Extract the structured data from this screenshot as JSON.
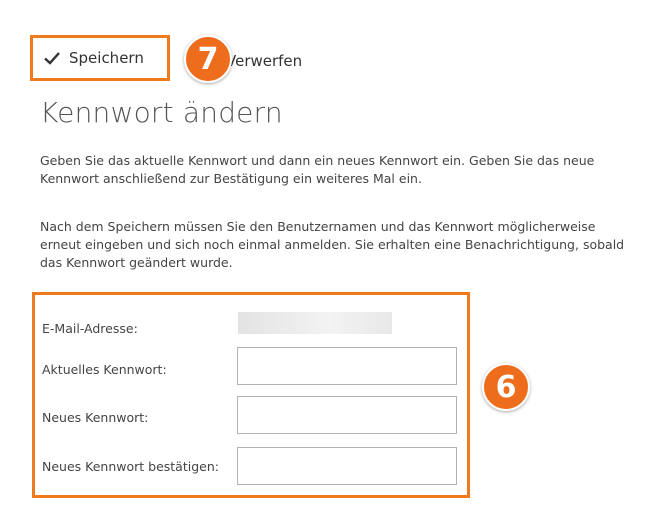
{
  "toolbar": {
    "save_label": "Speichern",
    "discard_label": "Verwerfen",
    "save_icon": "check-icon",
    "discard_icon": "close-icon"
  },
  "callouts": {
    "save_step": "7",
    "form_step": "6",
    "color": "#ee6d1d"
  },
  "page": {
    "title": "Kennwort ändern",
    "intro_1": "Geben Sie das aktuelle Kennwort und dann ein neues Kennwort ein. Geben Sie das neue Kennwort anschließend zur Bestätigung ein weiteres Mal ein.",
    "intro_2": "Nach dem Speichern müssen Sie den Benutzernamen und das Kennwort möglicherweise erneut eingeben und sich noch einmal anmelden. Sie erhalten eine Benachrichtigung, sobald das Kennwort geändert wurde."
  },
  "form": {
    "email_label": "E-Mail-Adresse:",
    "current_password_label": "Aktuelles Kennwort:",
    "new_password_label": "Neues Kennwort:",
    "confirm_password_label": "Neues Kennwort bestätigen:",
    "current_password_value": "",
    "new_password_value": "",
    "confirm_password_value": ""
  },
  "colors": {
    "highlight_border": "#f07a1c",
    "badge_fill": "#ee6d1d"
  }
}
